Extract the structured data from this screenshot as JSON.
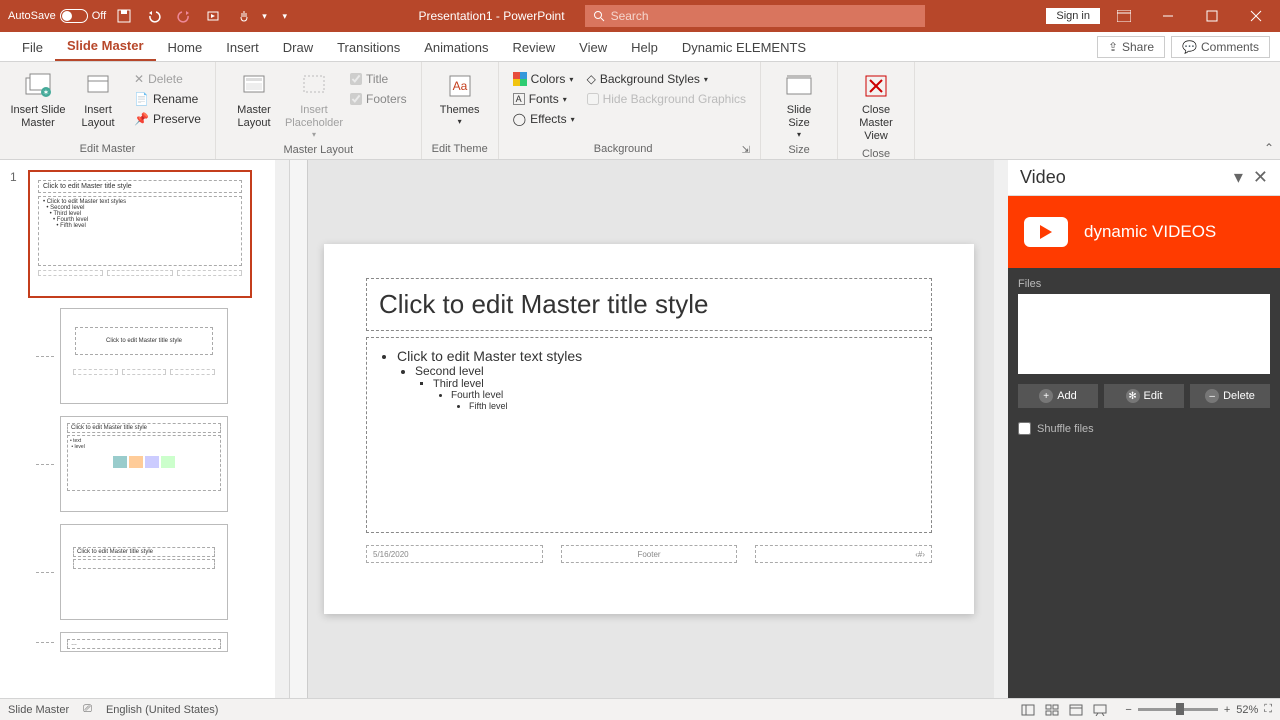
{
  "titlebar": {
    "autosave_label": "AutoSave",
    "autosave_state": "Off",
    "doc_title": "Presentation1 - PowerPoint",
    "search_placeholder": "Search",
    "signin": "Sign in"
  },
  "tabs": {
    "file": "File",
    "slide_master": "Slide Master",
    "home": "Home",
    "insert": "Insert",
    "draw": "Draw",
    "transitions": "Transitions",
    "animations": "Animations",
    "review": "Review",
    "view": "View",
    "help": "Help",
    "dynamic": "Dynamic ELEMENTS",
    "share": "Share",
    "comments": "Comments"
  },
  "ribbon": {
    "edit_master": {
      "label": "Edit Master",
      "insert_slide_master": "Insert Slide\nMaster",
      "insert_layout": "Insert\nLayout",
      "delete": "Delete",
      "rename": "Rename",
      "preserve": "Preserve"
    },
    "master_layout": {
      "label": "Master Layout",
      "master_layout": "Master\nLayout",
      "insert_placeholder": "Insert\nPlaceholder",
      "title": "Title",
      "footers": "Footers"
    },
    "edit_theme": {
      "label": "Edit Theme",
      "themes": "Themes"
    },
    "background": {
      "label": "Background",
      "colors": "Colors",
      "fonts": "Fonts",
      "effects": "Effects",
      "bg_styles": "Background Styles",
      "hide_bg": "Hide Background Graphics"
    },
    "size": {
      "label": "Size",
      "slide_size": "Slide\nSize"
    },
    "close": {
      "label": "Close",
      "close_master": "Close\nMaster View"
    }
  },
  "slide": {
    "title_ph": "Click to edit Master title style",
    "body_l1": "Click to edit Master text styles",
    "body_l2": "Second level",
    "body_l3": "Third level",
    "body_l4": "Fourth level",
    "body_l5": "Fifth level",
    "date": "5/16/2020",
    "footer": "Footer",
    "number": "‹#›"
  },
  "thumbnails": {
    "master_num": "1",
    "layout2_title": "Click to edit Master title style",
    "layout3_title": "Click to edit Master title style",
    "layout4_title": "Click to edit Master title style"
  },
  "pane": {
    "title": "Video",
    "brand": "dynamic VIDEOS",
    "files_label": "Files",
    "add": "Add",
    "edit": "Edit",
    "delete": "Delete",
    "shuffle": "Shuffle files"
  },
  "status": {
    "mode": "Slide Master",
    "lang": "English (United States)",
    "zoom": "52%"
  }
}
